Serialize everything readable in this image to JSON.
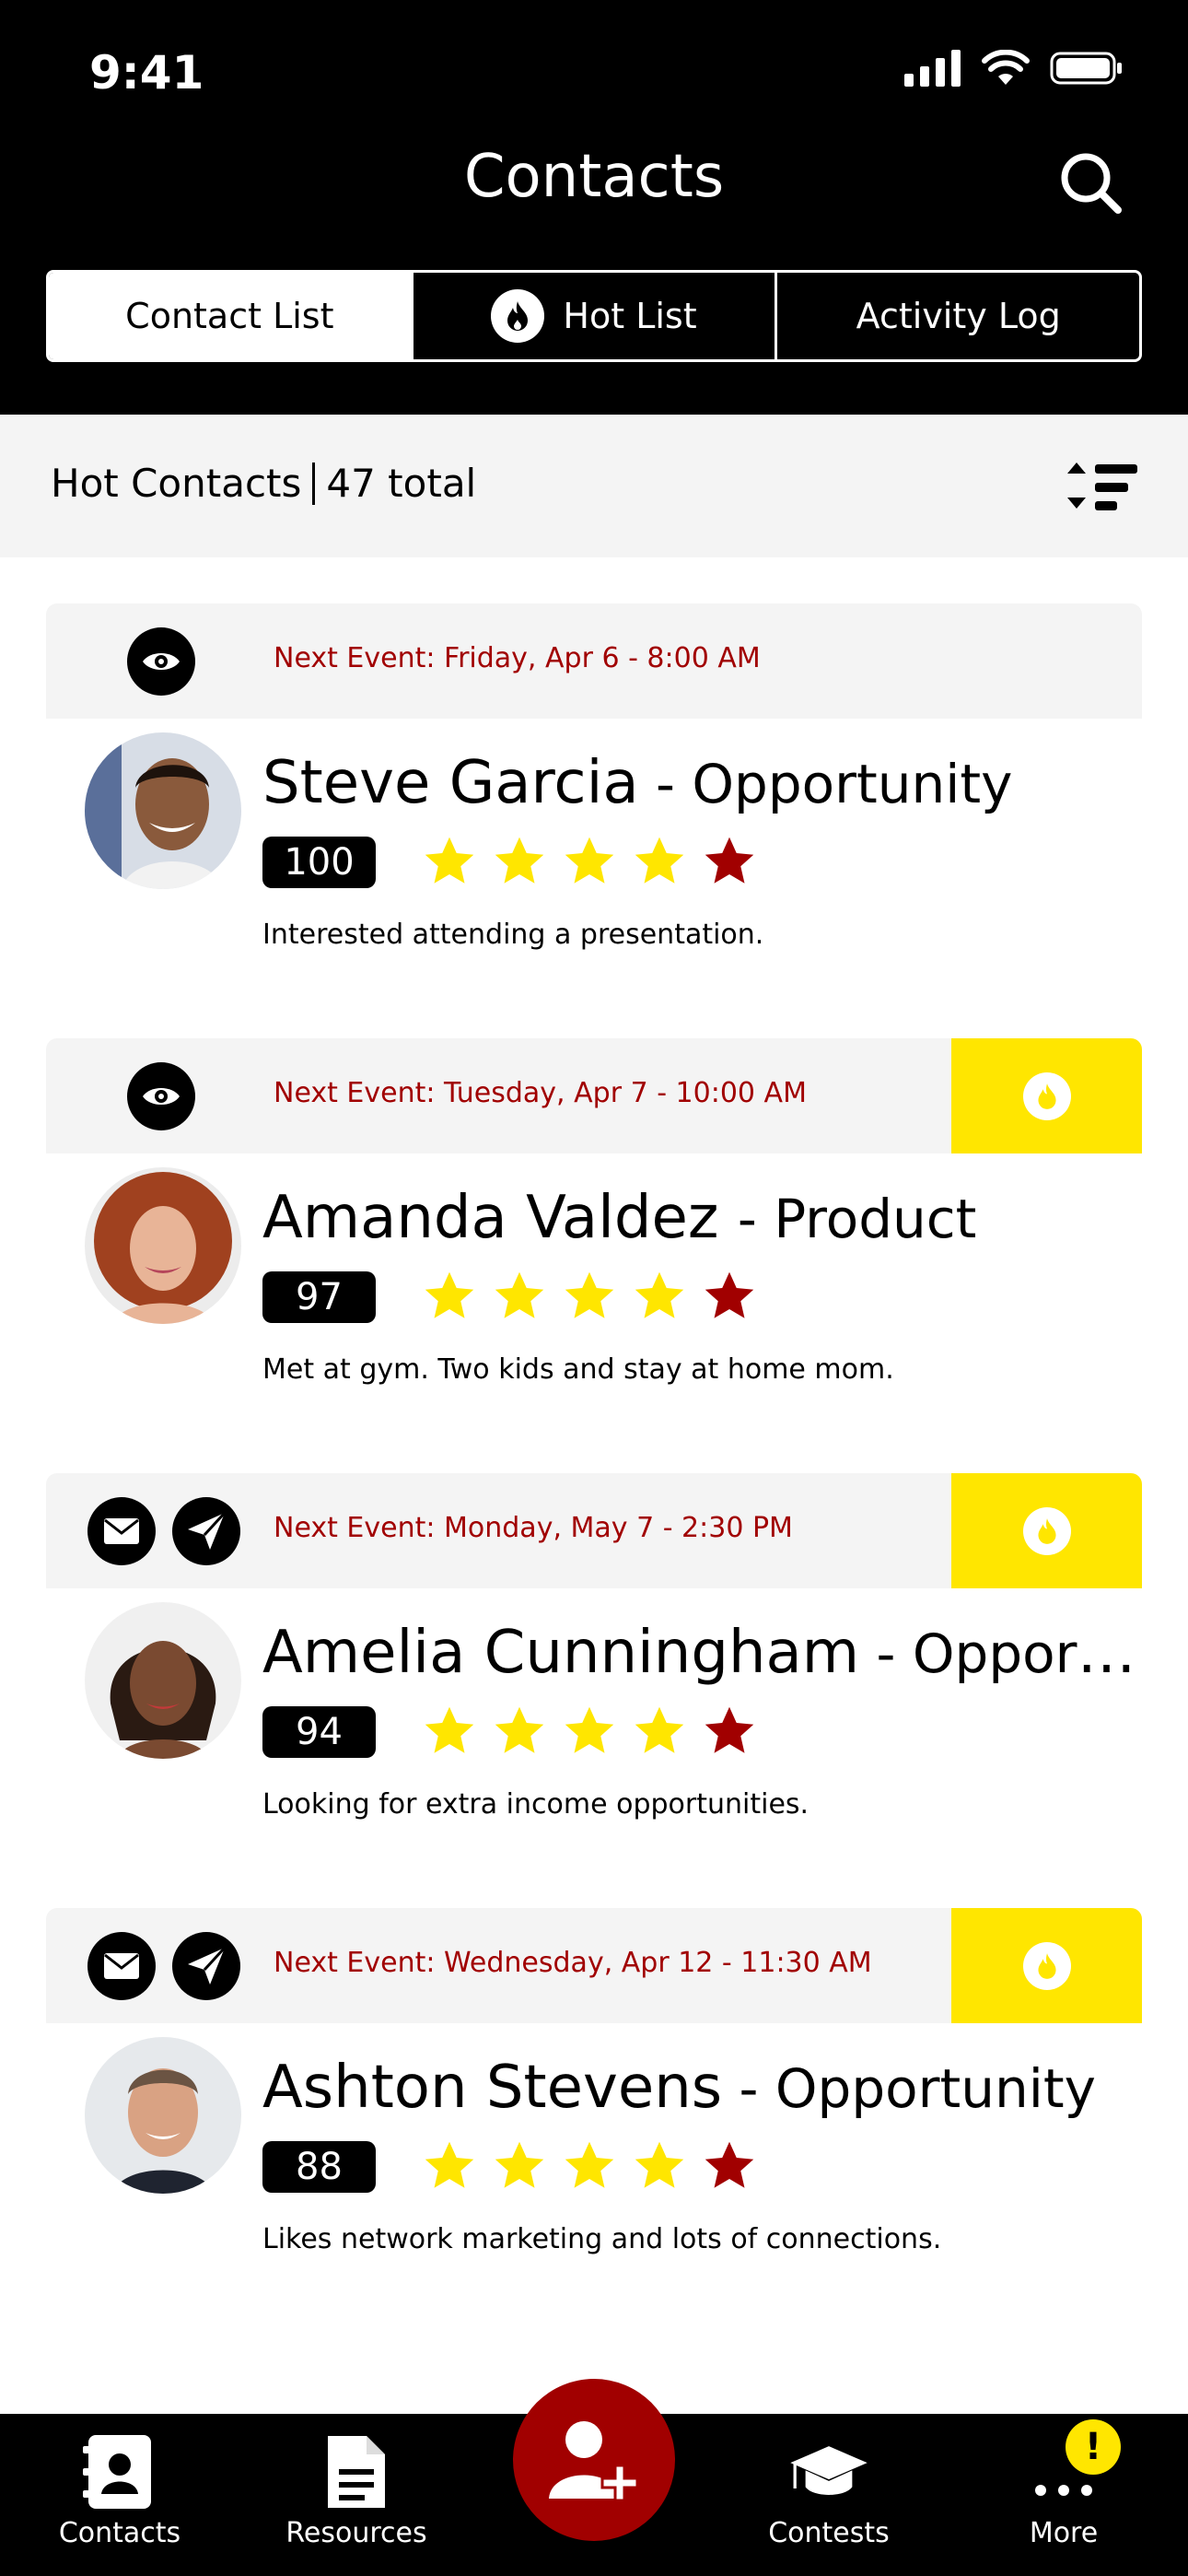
{
  "status_bar": {
    "time": "9:41"
  },
  "header": {
    "title": "Contacts"
  },
  "tabs": [
    {
      "label": "Contact List",
      "active": true
    },
    {
      "label": "Hot List",
      "active": false,
      "icon": "flame-icon"
    },
    {
      "label": "Activity Log",
      "active": false
    }
  ],
  "summary": {
    "label": "Hot Contacts",
    "count": "47 total"
  },
  "contacts": [
    {
      "event": "Next Event: Friday, Apr 6 - 8:00 AM",
      "name": "Steve Garcia",
      "type": " - Opportunity",
      "score": "100",
      "stars": 5,
      "note": "Interested attending a presentation.",
      "actions": [
        "eye-icon"
      ],
      "hot": false
    },
    {
      "event": "Next Event: Tuesday, Apr 7 - 10:00 AM",
      "name": "Amanda Valdez ",
      "type": " - Product",
      "score": "97",
      "stars": 5,
      "note": "Met at gym. Two kids and stay at home mom.",
      "actions": [
        "eye-icon"
      ],
      "hot": true
    },
    {
      "event": "Next Event: Monday, May 7 - 2:30 PM",
      "name": "Amelia Cunningham",
      "type": " - Opportu...",
      "score": "94",
      "stars": 5,
      "note": "Looking for extra income opportunities.",
      "actions": [
        "mail-icon",
        "send-icon"
      ],
      "hot": true
    },
    {
      "event": "Next Event: Wednesday, Apr 12 - 11:30 AM",
      "name": "Ashton Stevens",
      "type": " - Opportunity",
      "score": "88",
      "stars": 5,
      "note": "Likes network marketing and lots of connections.",
      "actions": [
        "mail-icon",
        "send-icon"
      ],
      "hot": true
    }
  ],
  "tabbar": {
    "items": [
      {
        "label": "Contacts",
        "icon": "contacts-book-icon"
      },
      {
        "label": "Resources",
        "icon": "document-icon"
      },
      {
        "label": "Contests",
        "icon": "graduation-cap-icon"
      },
      {
        "label": "More",
        "icon": "more-dots-icon"
      }
    ],
    "fab_icon": "add-contact-icon",
    "badge": "!"
  },
  "colors": {
    "header_bg": "#000000",
    "accent_red": "#a10000",
    "hot_yellow": "#ffe600",
    "star_yellow": "#ffe600",
    "star_red": "#a10000",
    "event_bar_bg": "#f4f4f4"
  }
}
